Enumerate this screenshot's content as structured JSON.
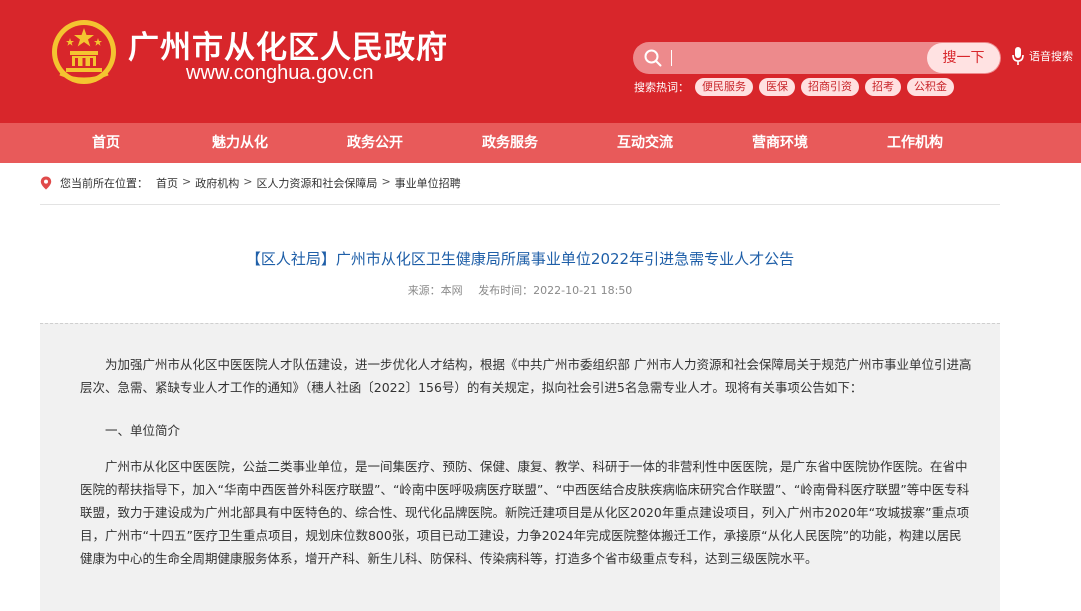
{
  "header": {
    "site_title": "广州市从化区人民政府",
    "site_url": "www.conghua.gov.cn",
    "search": {
      "placeholder": "",
      "button_label": "搜一下"
    },
    "voice_label": "语音搜索",
    "hot_label": "搜索热词：",
    "hot_tags": [
      "便民服务",
      "医保",
      "招商引资",
      "招考",
      "公积金"
    ]
  },
  "nav": {
    "items": [
      "首页",
      "魅力从化",
      "政务公开",
      "政务服务",
      "互动交流",
      "营商环境",
      "工作机构"
    ]
  },
  "breadcrumb": {
    "prefix": "您当前所在位置：",
    "items": [
      "首页",
      "政府机构",
      "区人力资源和社会保障局",
      "事业单位招聘"
    ],
    "separator": ">"
  },
  "article": {
    "title": "【区人社局】广州市从化区卫生健康局所属事业单位2022年引进急需专业人才公告",
    "source": "来源：本网",
    "publish_time": "发布时间：2022-10-21 18:50",
    "paragraphs": [
      "为加强广州市从化区中医医院人才队伍建设，进一步优化人才结构，根据《中共广州市委组织部 广州市人力资源和社会保障局关于规范广州市事业单位引进高层次、急需、紧缺专业人才工作的通知》（穗人社函〔2022〕156号）的有关规定，拟向社会引进5名急需专业人才。现将有关事项公告如下：",
      "一、单位简介",
      "广州市从化区中医医院，公益二类事业单位，是一间集医疗、预防、保健、康复、教学、科研于一体的非营利性中医医院，是广东省中医院协作医院。在省中医院的帮扶指导下，加入“华南中西医普外科医疗联盟”、“岭南中医呼吸病医疗联盟”、“中西医结合皮肤疾病临床研究合作联盟”、“岭南骨科医疗联盟”等中医专科联盟，致力于建设成为广州北部具有中医特色的、综合性、现代化品牌医院。新院迁建项目是从化区2020年重点建设项目，列入广州市2020年“攻城拔寨”重点项目，广州市“十四五”医疗卫生重点项目，规划床位数800张，项目已动工建设，力争2024年完成医院整体搬迁工作，承接原“从化人民医院”的功能，构建以居民健康为中心的生命全周期健康服务体系，增开产科、新生儿科、防保科、传染病科等，打造多个省市级重点专科，达到三级医院水平。"
    ]
  },
  "colors": {
    "header_red": "#d8262b",
    "nav_red": "#e85a5a",
    "title_blue": "#1f5fa8"
  },
  "icons": {
    "emblem": "national-emblem-icon",
    "search": "search-icon",
    "voice": "microphone-icon",
    "location": "location-pin-icon"
  }
}
